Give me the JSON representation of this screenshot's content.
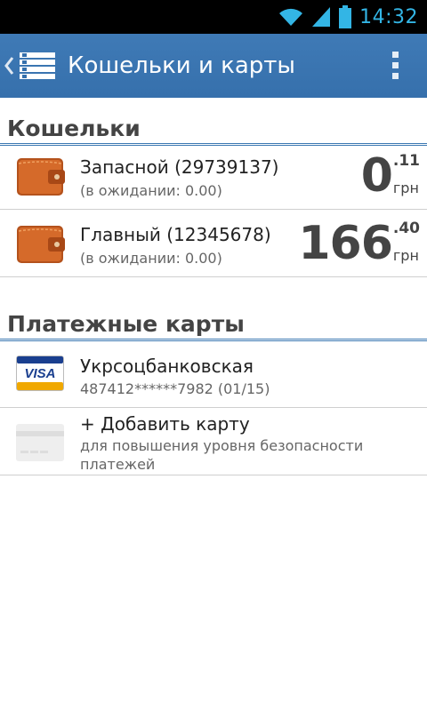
{
  "status_bar": {
    "time": "14:32",
    "icons": [
      "wifi-icon",
      "signal-icon",
      "battery-icon"
    ],
    "accent_color": "#33b5e5"
  },
  "action_bar": {
    "title": "Кошельки и карты",
    "background": "#3670ac",
    "icons": [
      "up-caret-icon",
      "menu-list-icon",
      "overflow-menu-icon"
    ]
  },
  "wallets_section": {
    "title": "Кошельки",
    "items": [
      {
        "name": "Запасной (29739137)",
        "pending": "(в ожидании: 0.00)",
        "balance_int": "0",
        "balance_frac": ".11",
        "currency": "грн",
        "icon": "wallet-icon"
      },
      {
        "name": "Главный (12345678)",
        "pending": "(в ожидании: 0.00)",
        "balance_int": "166",
        "balance_frac": ".40",
        "currency": "грн",
        "icon": "wallet-icon"
      }
    ]
  },
  "cards_section": {
    "title": "Платежные карты",
    "items": [
      {
        "name": "Укрсоцбанковская",
        "number": "487412******7982 (01/15)",
        "icon": "visa-card-icon",
        "brand_text": "VISA"
      }
    ],
    "add_card": {
      "label": "+ Добавить карту",
      "description": "для повышения уровня безопасности платежей",
      "icon": "blank-card-icon"
    }
  }
}
